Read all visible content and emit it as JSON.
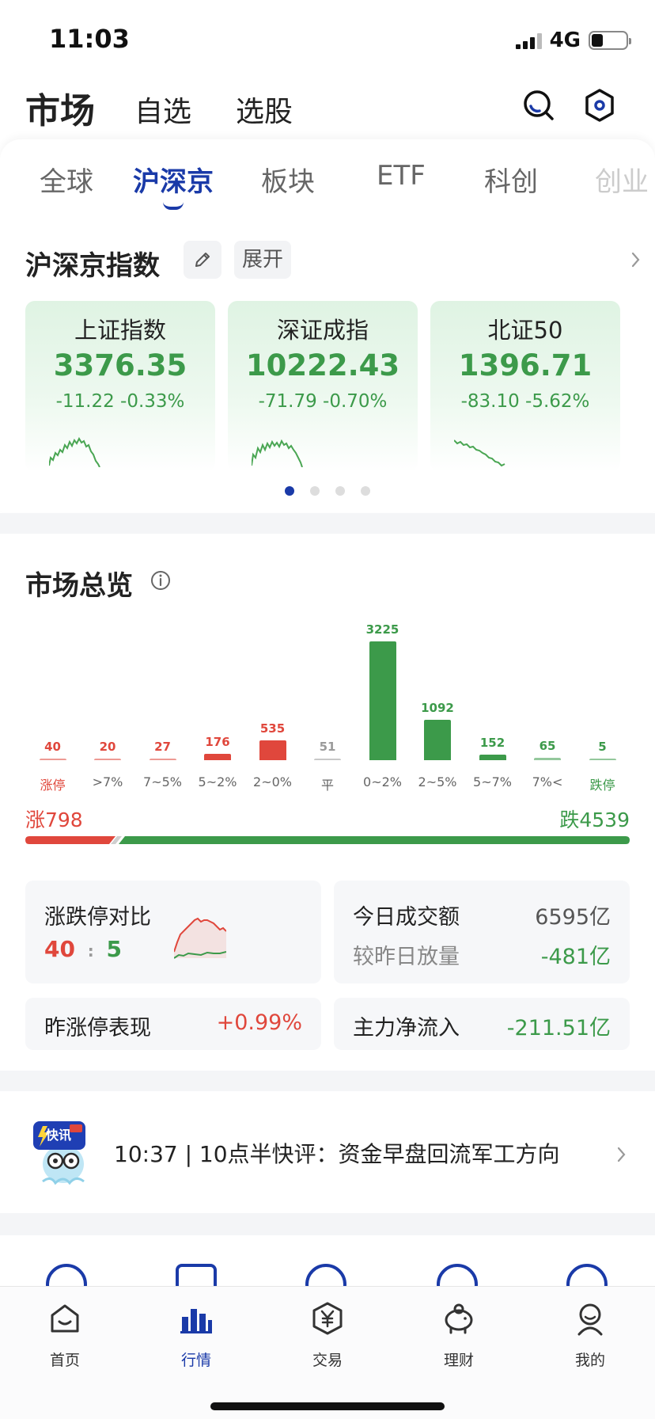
{
  "status_bar": {
    "time": "11:03",
    "network": "4G"
  },
  "header": {
    "tabs": [
      {
        "label": "市场",
        "active": true
      },
      {
        "label": "自选",
        "active": false
      },
      {
        "label": "选股",
        "active": false
      }
    ],
    "icons": [
      "search-icon",
      "settings-icon"
    ]
  },
  "sub_tabs": [
    {
      "label": "全球",
      "active": false
    },
    {
      "label": "沪深京",
      "active": true
    },
    {
      "label": "板块",
      "active": false
    },
    {
      "label": "ETF",
      "active": false
    },
    {
      "label": "科创",
      "active": false
    },
    {
      "label": "创业",
      "active": false
    }
  ],
  "indices_section": {
    "title": "沪深京指数",
    "edit_icon": "pencil-icon",
    "expand_label": "展开",
    "cards": [
      {
        "name": "上证指数",
        "value": "3376.35",
        "change": "-11.22 -0.33%"
      },
      {
        "name": "深证成指",
        "value": "10222.43",
        "change": "-71.79 -0.70%"
      },
      {
        "name": "北证50",
        "value": "1396.71",
        "change": "-83.10 -5.62%"
      }
    ],
    "pager": {
      "count": 4,
      "active": 1
    }
  },
  "market_overview": {
    "title": "市场总览",
    "info_icon": "info-icon",
    "chart_data": {
      "type": "bar",
      "categories": [
        "涨停",
        ">7%",
        "7~5%",
        "5~2%",
        "2~0%",
        "平",
        "0~2%",
        "2~5%",
        "5~7%",
        "7%<",
        "跌停"
      ],
      "values": [
        40,
        20,
        27,
        176,
        535,
        51,
        3225,
        1092,
        152,
        65,
        5
      ],
      "colors": [
        "#e0473c",
        "#e0473c",
        "#e0473c",
        "#e0473c",
        "#e0473c",
        "#9a9a9a",
        "#3c9a4a",
        "#3c9a4a",
        "#3c9a4a",
        "#3c9a4a",
        "#3c9a4a"
      ]
    },
    "up_count_label": "涨798",
    "down_count_label": "跌4539",
    "up_count": 798,
    "down_count": 4539,
    "limit_compare": {
      "label": "涨跌停对比",
      "up": "40",
      "sep": ":",
      "down": "5"
    },
    "turnover": {
      "label": "今日成交额",
      "value": "6595亿",
      "sub_label": "较昨日放量",
      "sub_value": "-481亿"
    },
    "yesterday_limit": {
      "label": "昨涨停表现",
      "value": "+0.99%"
    },
    "main_inflow": {
      "label": "主力净流入",
      "value": "-211.51亿"
    }
  },
  "news": {
    "badge": "快讯",
    "text": "10:37 | 10点半快评：资金早盘回流军工方向"
  },
  "tab_bar": [
    {
      "label": "首页",
      "icon": "home-icon",
      "active": false
    },
    {
      "label": "行情",
      "icon": "market-chart-icon",
      "active": true
    },
    {
      "label": "交易",
      "icon": "yuan-trade-icon",
      "active": false
    },
    {
      "label": "理财",
      "icon": "piggy-bank-icon",
      "active": false
    },
    {
      "label": "我的",
      "icon": "profile-icon",
      "active": false
    }
  ],
  "colors": {
    "accent": "#1a3aa8",
    "up": "#e0473c",
    "down": "#3c9a4a"
  }
}
